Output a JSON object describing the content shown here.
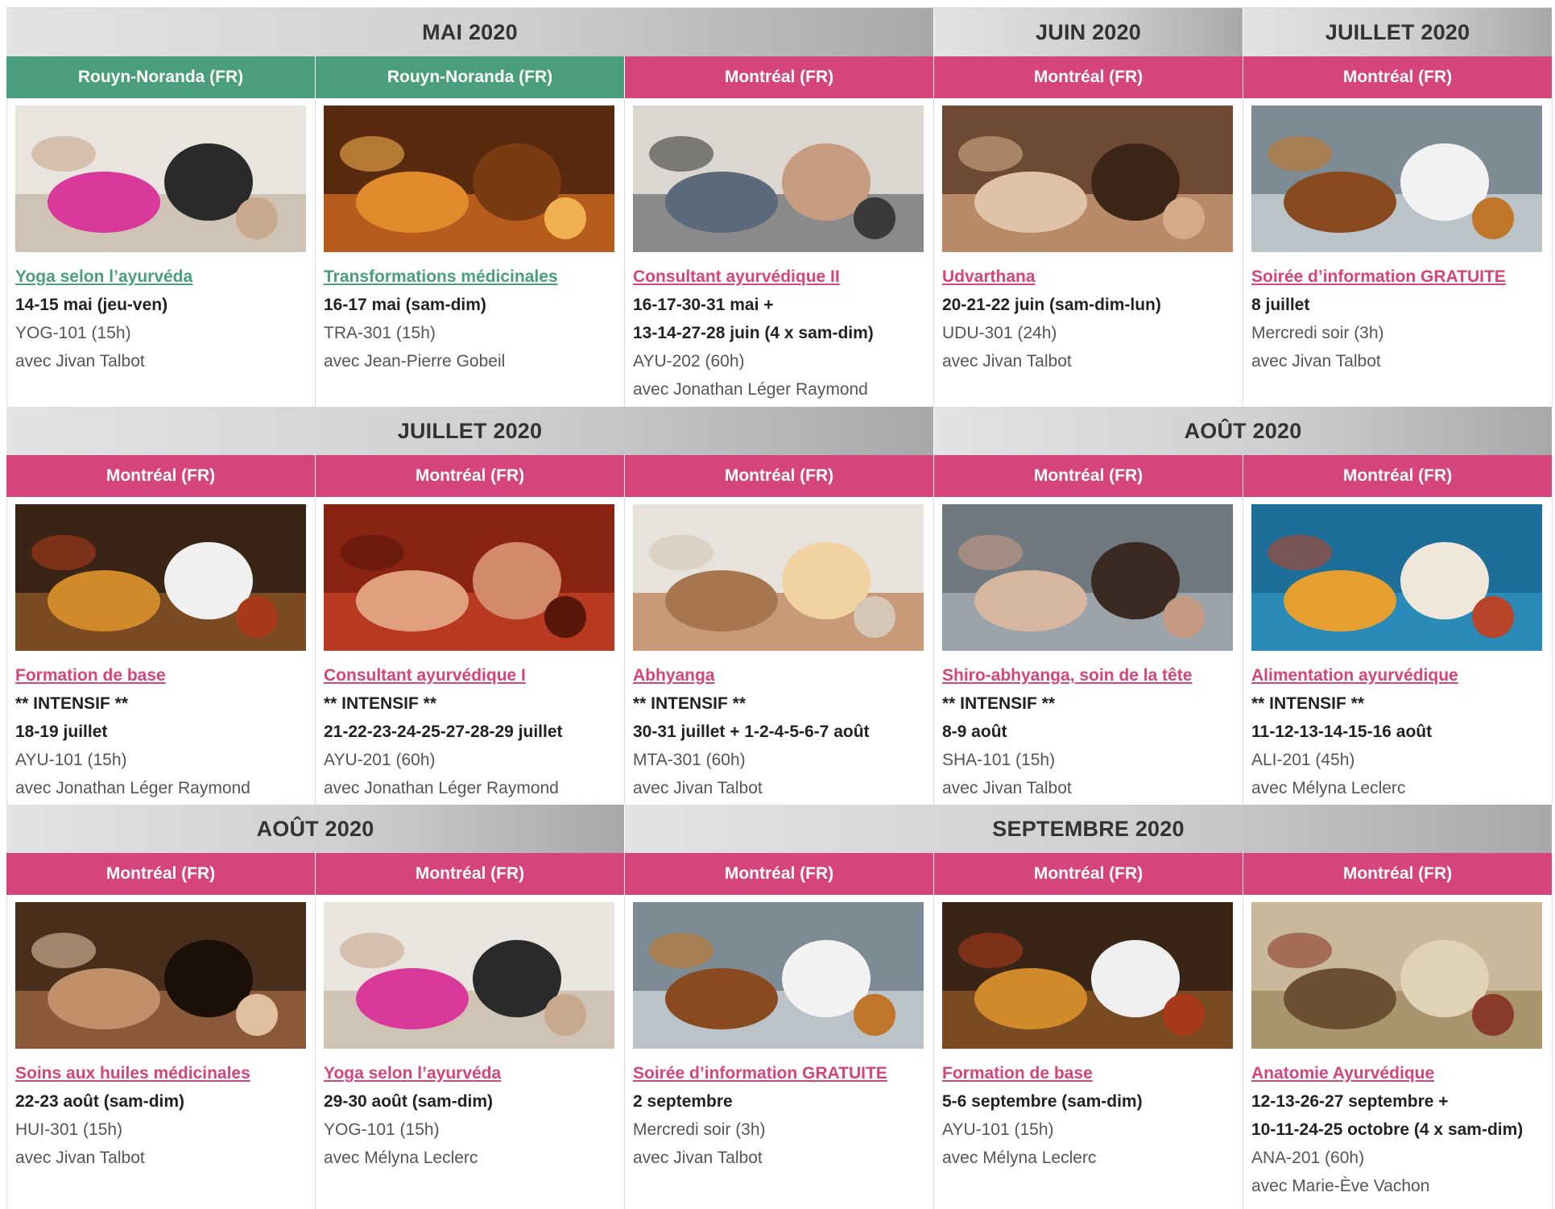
{
  "colors": {
    "rose": "#d5447a",
    "green": "#4a9e7d",
    "header_gray": "#cfcfcf"
  },
  "rows": [
    {
      "months": [
        {
          "label": "MAI 2020",
          "span": 3
        },
        {
          "label": "JUIN 2020",
          "span": 1
        },
        {
          "label": "JUILLET 2020",
          "span": 1
        }
      ],
      "cards": [
        {
          "location": "Rouyn-Noranda (FR)",
          "color": "green",
          "image": "yoga-stretching-photo",
          "title": "Yoga selon l’ayurvéda",
          "lines": [
            {
              "text": "14-15 mai (jeu-ven)",
              "bold": true
            },
            {
              "text": "YOG-101 (15h)",
              "bold": false
            },
            {
              "text": "avec Jivan Talbot",
              "bold": false
            }
          ]
        },
        {
          "location": "Rouyn-Noranda (FR)",
          "color": "green",
          "image": "herbal-tea-spices-photo",
          "title": "Transformations médicinales",
          "lines": [
            {
              "text": "16-17 mai (sam-dim)",
              "bold": true
            },
            {
              "text": "TRA-301 (15h)",
              "bold": false
            },
            {
              "text": "avec Jean-Pierre Gobeil",
              "bold": false
            }
          ]
        },
        {
          "location": "Montréal (FR)",
          "color": "rose",
          "image": "consultation-photo",
          "title": "Consultant ayurvédique II",
          "lines": [
            {
              "text": "16-17-30-31 mai +",
              "bold": true
            },
            {
              "text": "13-14-27-28 juin (4 x sam-dim)",
              "bold": true
            },
            {
              "text": "AYU-202 (60h)",
              "bold": false
            },
            {
              "text": "avec Jonathan Léger Raymond",
              "bold": false
            }
          ]
        },
        {
          "location": "Montréal (FR)",
          "color": "rose",
          "image": "back-scrub-massage-photo",
          "title": "Udvarthana",
          "lines": [
            {
              "text": "20-21-22 juin (sam-dim-lun)",
              "bold": true
            },
            {
              "text": "UDU-301 (24h)",
              "bold": false
            },
            {
              "text": "avec Jivan Talbot",
              "bold": false
            }
          ]
        },
        {
          "location": "Montréal (FR)",
          "color": "rose",
          "image": "spices-mortar-photo",
          "title": "Soirée d’information GRATUITE",
          "lines": [
            {
              "text": "8 juillet",
              "bold": true
            },
            {
              "text": "Mercredi soir (3h)",
              "bold": false
            },
            {
              "text": "avec Jivan Talbot",
              "bold": false
            }
          ]
        }
      ]
    },
    {
      "months": [
        {
          "label": "JUILLET 2020",
          "span": 3
        },
        {
          "label": "AOÛT 2020",
          "span": 2
        }
      ],
      "cards": [
        {
          "location": "Montréal (FR)",
          "color": "rose",
          "image": "spice-bowls-photo",
          "title": "Formation de base",
          "lines": [
            {
              "text": "** INTENSIF **",
              "bold": true
            },
            {
              "text": "18-19 juillet",
              "bold": true
            },
            {
              "text": "AYU-101 (15h)",
              "bold": false
            },
            {
              "text": "avec Jonathan Léger Raymond",
              "bold": false
            }
          ]
        },
        {
          "location": "Montréal (FR)",
          "color": "rose",
          "image": "pulse-reading-photo",
          "title": "Consultant ayurvédique I",
          "lines": [
            {
              "text": "** INTENSIF **",
              "bold": true
            },
            {
              "text": "21-22-23-24-25-27-28-29 juillet",
              "bold": true
            },
            {
              "text": "AYU-201 (60h)",
              "bold": false
            },
            {
              "text": "avec Jonathan Léger Raymond",
              "bold": false
            }
          ]
        },
        {
          "location": "Montréal (FR)",
          "color": "rose",
          "image": "back-massage-photo",
          "title": "Abhyanga",
          "lines": [
            {
              "text": "** INTENSIF **",
              "bold": true
            },
            {
              "text": "30-31 juillet + 1-2-4-5-6-7 août",
              "bold": true
            },
            {
              "text": "MTA-301 (60h)",
              "bold": false
            },
            {
              "text": "avec Jivan Talbot",
              "bold": false
            }
          ]
        },
        {
          "location": "Montréal (FR)",
          "color": "rose",
          "image": "head-massage-photo",
          "title": "Shiro-abhyanga, soin de la tête",
          "lines": [
            {
              "text": "** INTENSIF **",
              "bold": true
            },
            {
              "text": "8-9 août",
              "bold": true
            },
            {
              "text": "SHA-101 (15h)",
              "bold": false
            },
            {
              "text": "avec Jivan Talbot",
              "bold": false
            }
          ]
        },
        {
          "location": "Montréal (FR)",
          "color": "rose",
          "image": "spices-blue-table-photo",
          "title": "Alimentation ayurvédique",
          "lines": [
            {
              "text": "** INTENSIF **",
              "bold": true
            },
            {
              "text": "11-12-13-14-15-16 août",
              "bold": true
            },
            {
              "text": "ALI-201 (45h)",
              "bold": false
            },
            {
              "text": "avec Mélyna Leclerc",
              "bold": false
            }
          ]
        }
      ]
    },
    {
      "months": [
        {
          "label": "AOÛT 2020",
          "span": 2
        },
        {
          "label": "SEPTEMBRE 2020",
          "span": 3
        }
      ],
      "cards": [
        {
          "location": "Montréal (FR)",
          "color": "rose",
          "image": "oil-pouring-photo",
          "title": "Soins aux huiles médicinales",
          "lines": [
            {
              "text": "22-23 août (sam-dim)",
              "bold": true
            },
            {
              "text": "HUI-301 (15h)",
              "bold": false
            },
            {
              "text": "avec Jivan Talbot",
              "bold": false
            }
          ]
        },
        {
          "location": "Montréal (FR)",
          "color": "rose",
          "image": "yoga-stretching-photo",
          "title": "Yoga selon l’ayurvéda",
          "lines": [
            {
              "text": "29-30 août (sam-dim)",
              "bold": true
            },
            {
              "text": "YOG-101 (15h)",
              "bold": false
            },
            {
              "text": "avec Mélyna Leclerc",
              "bold": false
            }
          ]
        },
        {
          "location": "Montréal (FR)",
          "color": "rose",
          "image": "spices-mortar-photo",
          "title": "Soirée d’information GRATUITE",
          "lines": [
            {
              "text": "2 septembre",
              "bold": true
            },
            {
              "text": "Mercredi soir (3h)",
              "bold": false
            },
            {
              "text": "avec Jivan Talbot",
              "bold": false
            }
          ]
        },
        {
          "location": "Montréal (FR)",
          "color": "rose",
          "image": "spice-bowls-photo",
          "title": "Formation de base",
          "lines": [
            {
              "text": "5-6 septembre (sam-dim)",
              "bold": true
            },
            {
              "text": "AYU-101 (15h)",
              "bold": false
            },
            {
              "text": "avec Mélyna Leclerc",
              "bold": false
            }
          ]
        },
        {
          "location": "Montréal (FR)",
          "color": "rose",
          "image": "anatomy-manuscript-photo",
          "title": "Anatomie Ayurvédique",
          "lines": [
            {
              "text": "12-13-26-27 septembre +",
              "bold": true
            },
            {
              "text": "10-11-24-25 octobre (4 x sam-dim)",
              "bold": true
            },
            {
              "text": "ANA-201 (60h)",
              "bold": false
            },
            {
              "text": "avec Marie-Ève Vachon",
              "bold": false
            }
          ]
        }
      ]
    }
  ]
}
